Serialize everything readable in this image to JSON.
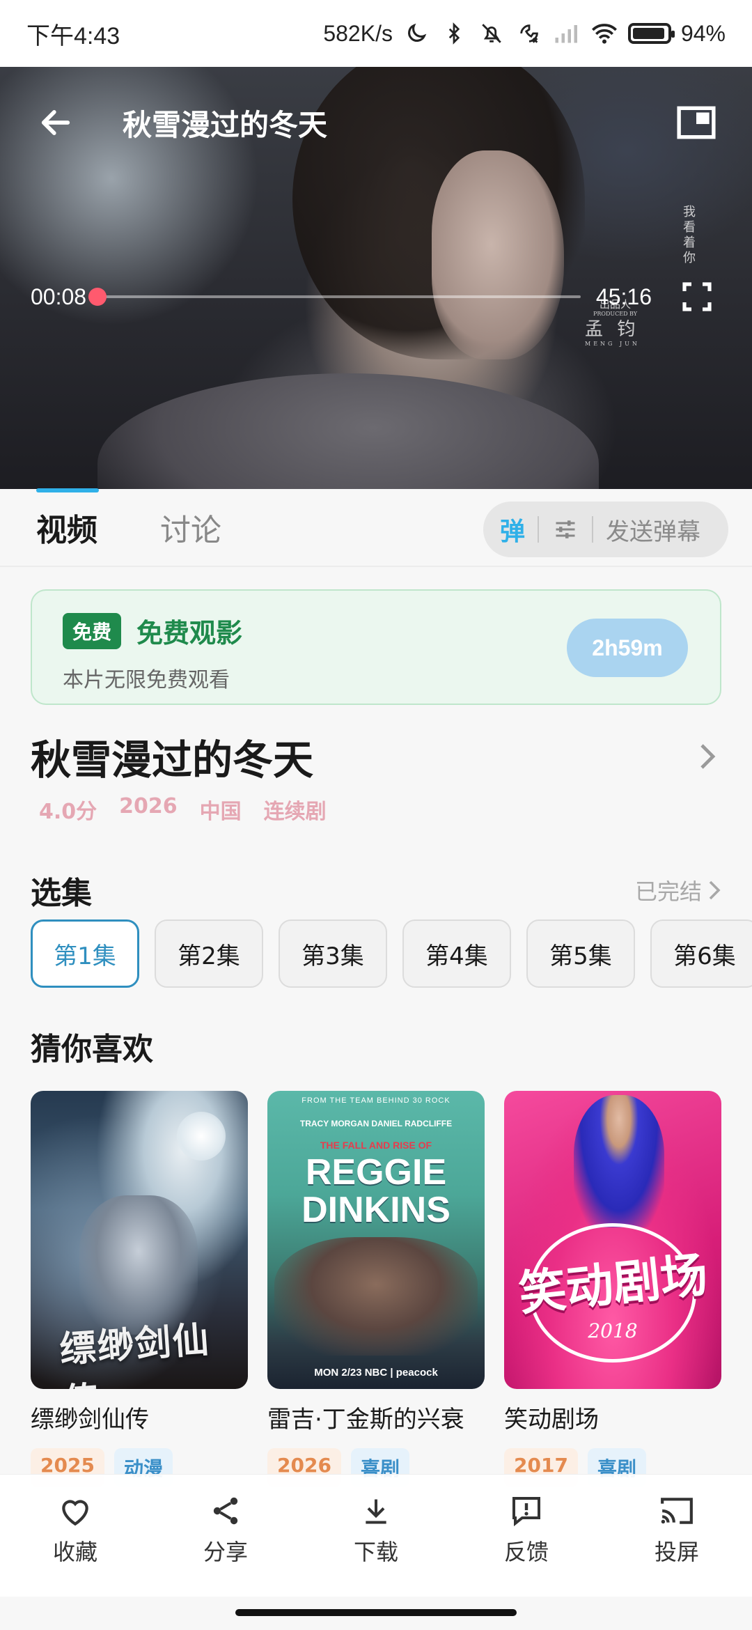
{
  "status_bar": {
    "time": "下午4:43",
    "network_speed": "582K/s",
    "battery_percent": "94%",
    "battery_level": 0.94,
    "icons": [
      "moon-icon",
      "bluetooth-icon",
      "bell-off-icon",
      "call-missed-icon",
      "signal-icon",
      "wifi-icon",
      "battery-icon"
    ]
  },
  "player": {
    "title": "秋雪漫过的冬天",
    "current_time": "00:08",
    "total_time": "45:16",
    "progress": 0.003,
    "overlay_text": {
      "vertical": "我看着你",
      "credit_label": "出品人",
      "credit_sub": "PRODUCED BY",
      "credit_name": "孟 钧",
      "credit_name_en": "MENG JUN"
    },
    "icons": [
      "arrow-left-icon",
      "picture-in-picture-icon",
      "fullscreen-icon"
    ]
  },
  "tabs": [
    {
      "label": "视频",
      "active": true
    },
    {
      "label": "讨论",
      "active": false
    }
  ],
  "danmu": {
    "toggle_label": "弹",
    "send_placeholder": "发送弹幕"
  },
  "free_banner": {
    "badge": "免费",
    "title": "免费观影",
    "description": "本片无限免费观看",
    "countdown": "2h59m"
  },
  "show": {
    "title": "秋雪漫过的冬天",
    "rating": "4.0分",
    "year": "2026",
    "region": "中国",
    "type": "连续剧"
  },
  "episodes_section": {
    "title": "选集",
    "status": "已完结",
    "episodes": [
      "第1集",
      "第2集",
      "第3集",
      "第4集",
      "第5集",
      "第6集"
    ],
    "selected_index": 0
  },
  "recommendations": {
    "title": "猜你喜欢",
    "items": [
      {
        "title": "缥缈剑仙传",
        "year": "2025",
        "genre": "动漫",
        "poster_text": {
          "logo": "缥缈剑仙传"
        }
      },
      {
        "title": "雷吉·丁金斯的兴衰",
        "year": "2026",
        "genre": "喜剧",
        "poster_text": {
          "top": "FROM THE TEAM BEHIND 30 ROCK",
          "names": "TRACY MORGAN    DANIEL RADCLIFFE",
          "small": "THE FALL AND RISE OF",
          "title": "REGGIE DINKINS",
          "bottom": "MON 2/23 NBC | peacock"
        }
      },
      {
        "title": "笑动剧场",
        "year": "2017",
        "genre": "喜剧",
        "poster_text": {
          "logo": "笑动剧场",
          "year": "2018"
        }
      }
    ]
  },
  "actions": [
    {
      "label": "收藏",
      "icon": "heart-icon"
    },
    {
      "label": "分享",
      "icon": "share-icon"
    },
    {
      "label": "下载",
      "icon": "download-icon"
    },
    {
      "label": "反馈",
      "icon": "feedback-icon"
    },
    {
      "label": "投屏",
      "icon": "cast-icon"
    }
  ],
  "colors": {
    "accent_blue": "#2fb0e8",
    "free_green": "#1f8a4c",
    "seek_thumb": "#ff5a6e",
    "meta_pink": "#e5a7b3"
  }
}
